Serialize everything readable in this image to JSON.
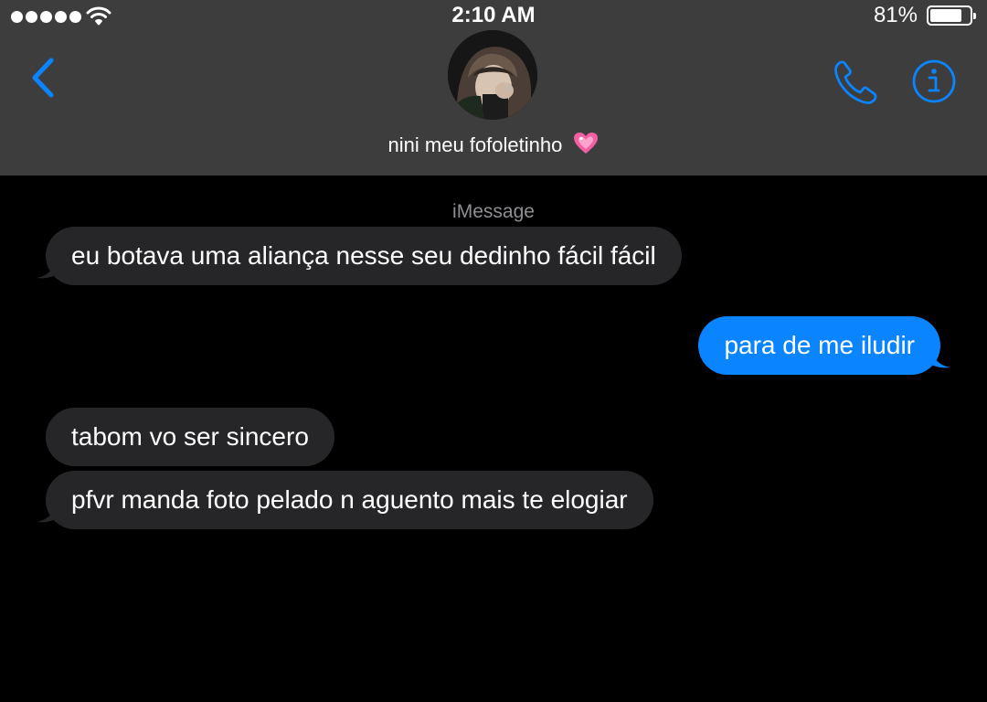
{
  "status_bar": {
    "time": "2:10 AM",
    "battery_percent": "81%",
    "battery_level": 0.81,
    "signal_bars": 5
  },
  "nav": {
    "back_icon": "chevron-left-icon",
    "contact_name": "nini meu fofoletinho",
    "contact_emoji": "💗",
    "call_icon": "phone-icon",
    "info_icon": "info-icon"
  },
  "thread": {
    "service_label": "iMessage",
    "messages": [
      {
        "direction": "received",
        "text": "eu botava uma aliança nesse seu dedinho fácil fácil"
      },
      {
        "direction": "sent",
        "text": "para de me iludir"
      },
      {
        "direction": "received",
        "text": "tabom vo ser sincero"
      },
      {
        "direction": "received",
        "text": "pfvr manda foto pelado n aguento mais te elogiar"
      }
    ]
  },
  "colors": {
    "header_bg": "#3d3d3d",
    "accent": "#0a84ff",
    "received_bubble": "#262628",
    "background": "#000000"
  }
}
